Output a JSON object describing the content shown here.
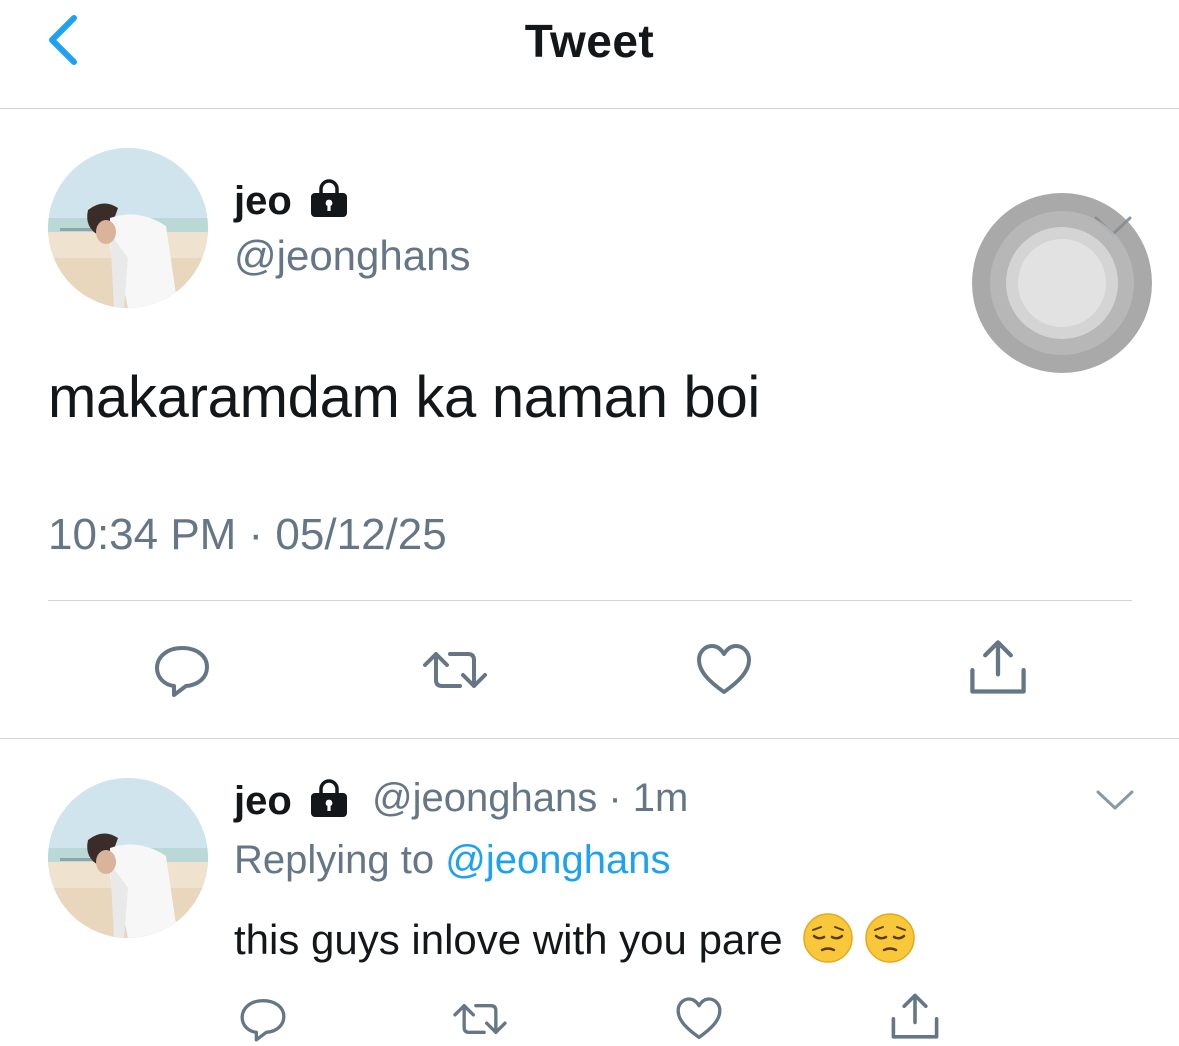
{
  "header": {
    "title": "Tweet",
    "back_icon": "chevron-left-icon",
    "accent_color": "#1da1f2"
  },
  "main_tweet": {
    "display_name": "jeo",
    "handle": "@jeonghans",
    "protected_icon": "lock-icon",
    "text": "makaramdam ka naman boi",
    "timestamp": "10:34 PM · 05/12/25",
    "actions": [
      "reply-icon",
      "retweet-icon",
      "like-icon",
      "share-icon"
    ]
  },
  "reply_tweet": {
    "display_name": "jeo",
    "handle_time": "@jeonghans · 1m",
    "replying_prefix": "Replying to",
    "replying_to": "@jeonghans",
    "text": "this guys inlove with you pare",
    "emojis": [
      "pensive-face-emoji",
      "pensive-face-emoji"
    ],
    "actions": [
      "reply-icon",
      "retweet-icon",
      "like-icon",
      "share-icon"
    ]
  },
  "colors": {
    "text_primary": "#14171a",
    "text_secondary": "#657786",
    "link": "#1da1f2",
    "divider": "#cfd4d9"
  }
}
